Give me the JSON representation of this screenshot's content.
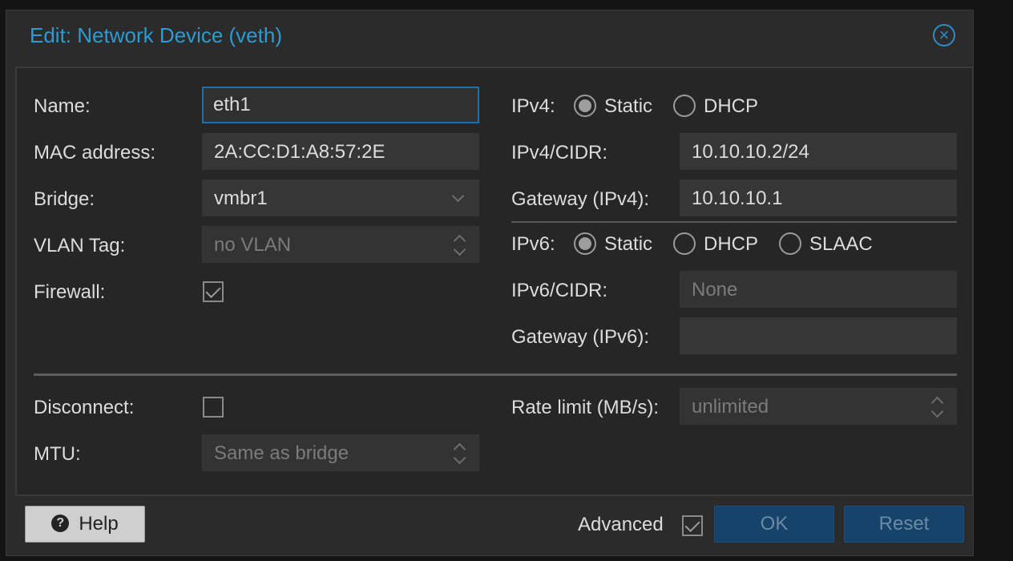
{
  "dialog": {
    "title": "Edit: Network Device (veth)",
    "close_icon": "close-circle-icon"
  },
  "left": {
    "name_label": "Name:",
    "name_value": "eth1",
    "mac_label": "MAC address:",
    "mac_value": "2A:CC:D1:A8:57:2E",
    "bridge_label": "Bridge:",
    "bridge_value": "vmbr1",
    "vlan_label": "VLAN Tag:",
    "vlan_placeholder": "no VLAN",
    "firewall_label": "Firewall:",
    "firewall_checked": true
  },
  "right": {
    "ipv4_label": "IPv4:",
    "ipv4_static": "Static",
    "ipv4_dhcp": "DHCP",
    "ipv4_mode": "Static",
    "ipv4_cidr_label": "IPv4/CIDR:",
    "ipv4_cidr_value": "10.10.10.2/24",
    "gw4_label": "Gateway (IPv4):",
    "gw4_value": "10.10.10.1",
    "ipv6_label": "IPv6:",
    "ipv6_static": "Static",
    "ipv6_dhcp": "DHCP",
    "ipv6_slaac": "SLAAC",
    "ipv6_mode": "Static",
    "ipv6_cidr_label": "IPv6/CIDR:",
    "ipv6_cidr_placeholder": "None",
    "gw6_label": "Gateway (IPv6):",
    "gw6_value": ""
  },
  "advanced": {
    "disconnect_label": "Disconnect:",
    "disconnect_checked": false,
    "mtu_label": "MTU:",
    "mtu_placeholder": "Same as bridge",
    "rate_label": "Rate limit (MB/s):",
    "rate_placeholder": "unlimited"
  },
  "footer": {
    "help_label": "Help",
    "help_icon": "question-circle-icon",
    "advanced_label": "Advanced",
    "advanced_checked": true,
    "ok_label": "OK",
    "reset_label": "Reset"
  },
  "colors": {
    "accent": "#2e9ad0",
    "primary_button": "#15436a",
    "background": "#2b2b2b"
  }
}
